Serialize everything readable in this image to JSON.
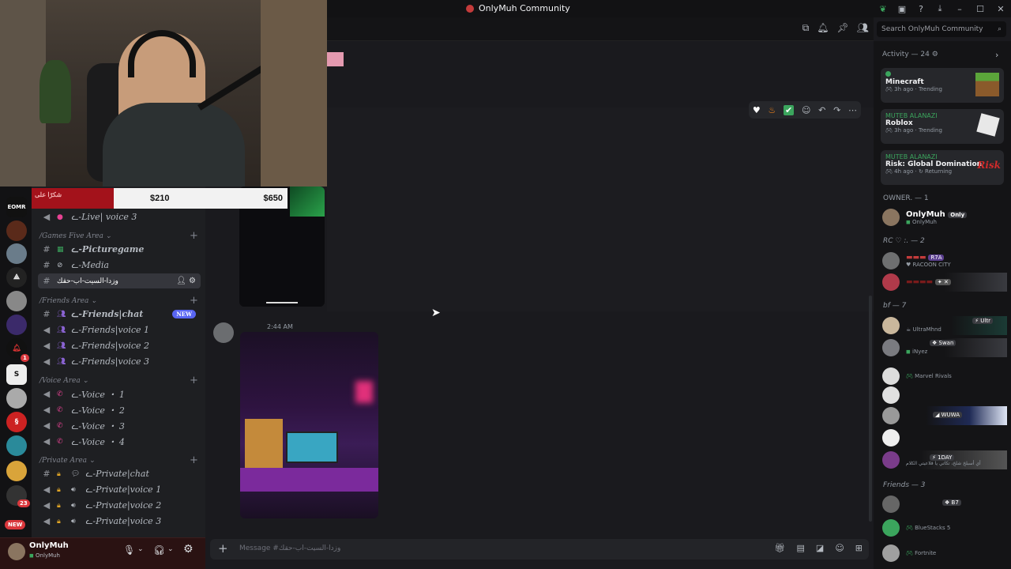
{
  "window": {
    "title": "OnlyMuh Community"
  },
  "search": {
    "placeholder": "Search OnlyMuh Community"
  },
  "donation": {
    "left_text": "شكرًا على",
    "amount1": "$210",
    "amount2": "$650"
  },
  "channels": {
    "voice_live": "ᓚ-Live| voice 3",
    "cat_games": "Games Five Area",
    "picturegame": "ᓚ-Picturegame",
    "media": "ᓚ-Media",
    "selected_channel": "وزدا-السيت-اب-حقك",
    "cat_friends": "Friends Area",
    "friends_chat": "ᓚ-Friends|chat",
    "friends_voice1": "ᓚ-Friends|voice 1",
    "friends_voice2": "ᓚ-Friends|voice 2",
    "friends_voice3": "ᓚ-Friends|voice 3",
    "new_badge": "NEW",
    "cat_voice": "Voice Area",
    "voice1": "ᓚ-Voice ・ 1",
    "voice2": "ᓚ-Voice ・ 2",
    "voice3": "ᓚ-Voice ・ 3",
    "voice4": "ᓚ-Voice ・ 4",
    "cat_private": "Private Area",
    "private_chat": "ᓚ-Private|chat",
    "private_voice1": "ᓚ-Private|voice 1",
    "private_voice2": "ᓚ-Private|voice 2",
    "private_voice3": "ᓚ-Private|voice 3"
  },
  "servers": {
    "badge1": "1",
    "badge2": "23",
    "new": "NEW"
  },
  "user": {
    "name": "OnlyMuh",
    "status": "OnlyMuh"
  },
  "message": {
    "time": "2:44 AM",
    "placeholder": "Message #وزدا-السيت-اب-حقك"
  },
  "activity": {
    "header": "Activity — 24",
    "cards": [
      {
        "user": "",
        "game": "Minecraft",
        "meta": "3h ago",
        "tag": "Trending"
      },
      {
        "user": "MUTEB ALANAZI",
        "game": "Roblox",
        "meta": "3h ago",
        "tag": "Trending"
      },
      {
        "user": "MUTEB ALANAZI",
        "game": "Risk: Global Domination",
        "meta": "4h ago",
        "tag": "Returning",
        "logo": "Risk"
      }
    ]
  },
  "members": {
    "owner_header": "OWNER. — 1",
    "owner_name": "OnlyMuh",
    "owner_tag": "Only",
    "owner_status": "OnlyMuh",
    "rc_header": "RC ♡ :. — 2",
    "rc_tag": "R7A",
    "rc_status": "RACOON CITY",
    "bf_header": "bf — 7",
    "bf1_tag": "Ultr",
    "bf1_status": "UltraMhnd",
    "bf2_tag": "Swan",
    "bf2_status": "iNyez",
    "bf3_status": "Marvel Rivals",
    "bf4_tag": "WUWA",
    "bf5_tag": "1DAY",
    "bf5_status": "أي أسبلخ شلخ، تكاتي يا قلاعيتي الكلام",
    "friends_header": "Friends — 3",
    "fr1_tag": "B7",
    "fr2_status": "BlueStacks 5",
    "fr3_status": "Fortnite"
  }
}
